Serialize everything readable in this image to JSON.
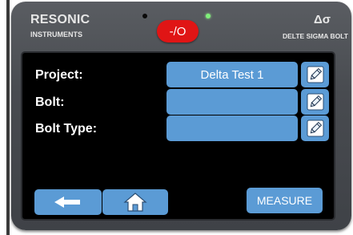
{
  "device": {
    "brand": "RESONIC",
    "brand_sub": "INSTRUMENTS",
    "model_symbol": "Δσ",
    "model_name": "DELTE SIGMA BOLT",
    "power_label": "-/O"
  },
  "form": {
    "fields": [
      {
        "label": "Project:",
        "value": "Delta Test 1",
        "edit_icon": "pencil-icon"
      },
      {
        "label": "Bolt:",
        "value": "",
        "edit_icon": "pencil-icon"
      },
      {
        "label": "Bolt Type:",
        "value": "",
        "edit_icon": "pencil-icon"
      }
    ]
  },
  "footer": {
    "back_icon": "arrow-left-icon",
    "home_icon": "home-icon",
    "measure_label": "MEASURE"
  },
  "colors": {
    "button_blue": "#5b9bd5",
    "power_red": "#e01515",
    "led_green": "#7ff07a",
    "screen_bg": "#000000",
    "bezel": "#4a4d52"
  }
}
